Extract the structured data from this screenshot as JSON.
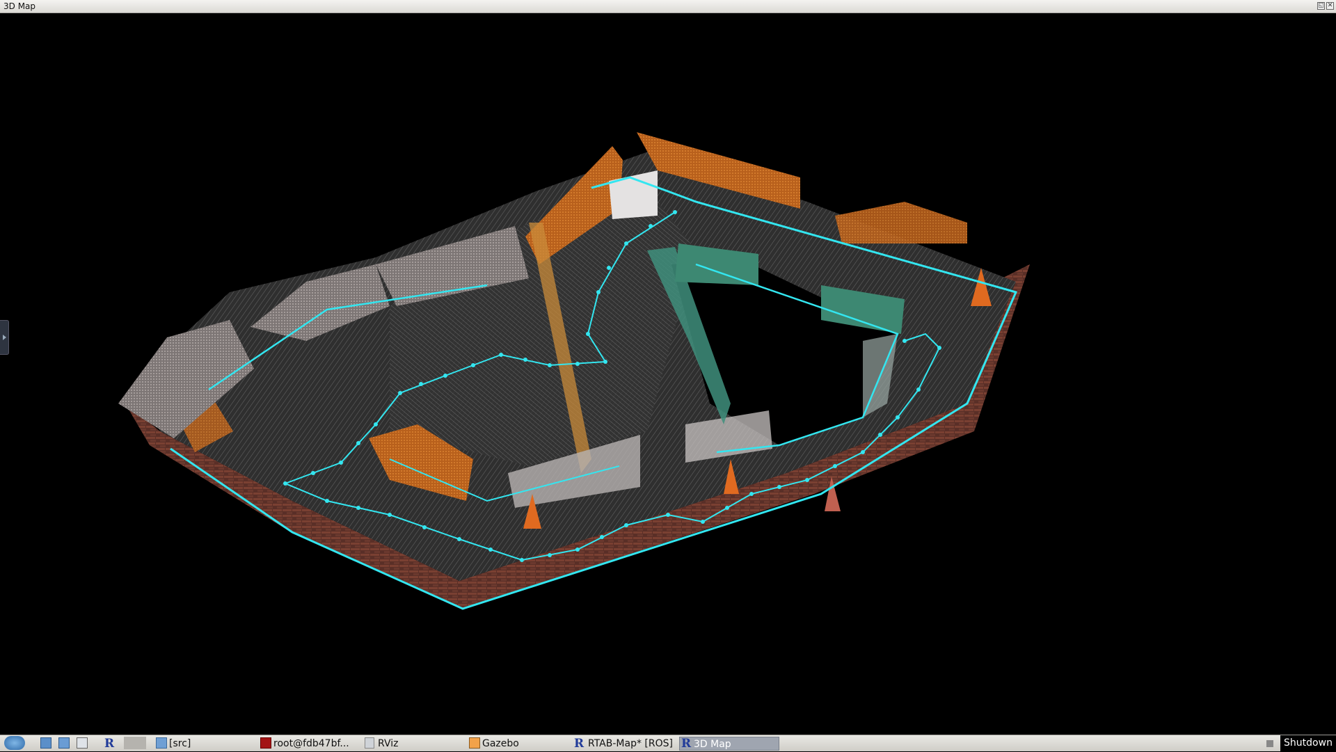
{
  "window": {
    "title": "3D Map"
  },
  "viewer": {
    "background": "#000000",
    "path_color": "#33e6f0",
    "wall_orange": "#c46a1e",
    "wall_gray": "#8a8482",
    "wall_teal": "#3f8f7c",
    "brick": "#6b3a30",
    "floor": "#3a3a3a"
  },
  "taskbar": {
    "items": [
      {
        "label": "[src]",
        "icon": "folder-icon"
      },
      {
        "label": "root@fdb47bf...",
        "icon": "terminal-icon"
      },
      {
        "label": "RViz",
        "icon": "rviz-icon"
      },
      {
        "label": "Gazebo",
        "icon": "gazebo-icon"
      },
      {
        "label": "RTAB-Map* [ROS]",
        "icon": "rtabmap-icon"
      },
      {
        "label": "3D Map",
        "icon": "rtabmap-icon"
      }
    ],
    "launcher_r": "R",
    "shutdown_label": "Shutdown"
  }
}
